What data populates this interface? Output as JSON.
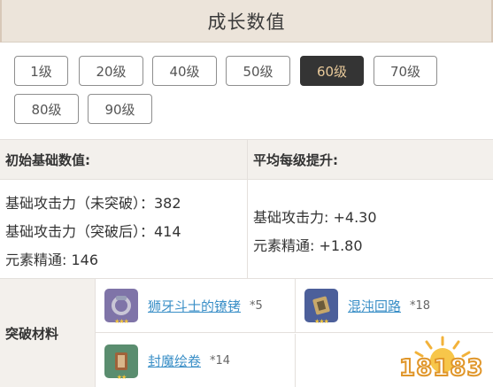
{
  "title": "成长数值",
  "levels": [
    {
      "label": "1级",
      "active": false
    },
    {
      "label": "20级",
      "active": false
    },
    {
      "label": "40级",
      "active": false
    },
    {
      "label": "50级",
      "active": false
    },
    {
      "label": "60级",
      "active": true
    },
    {
      "label": "70级",
      "active": false
    },
    {
      "label": "80级",
      "active": false
    },
    {
      "label": "90级",
      "active": false
    }
  ],
  "initial_stats": {
    "header": "初始基础数值:",
    "lines": [
      "基础攻击力（未突破）：382",
      "基础攻击力（突破后）：414",
      "元素精通: 146"
    ]
  },
  "growth_stats": {
    "header": "平均每级提升:",
    "lines": [
      "基础攻击力:  +4.30",
      "元素精通:  +1.80"
    ]
  },
  "materials": {
    "label": "突破材料",
    "items": [
      {
        "name": "狮牙斗士的镣铐",
        "count": "*5",
        "icon": "shackles-icon",
        "bg": "#7f74a8"
      },
      {
        "name": "混沌回路",
        "count": "*18",
        "icon": "circuit-icon",
        "bg": "#4c5f9a"
      },
      {
        "name": "封魔绘卷",
        "count": "*14",
        "icon": "scroll-icon",
        "bg": "#5a8d6f"
      }
    ]
  },
  "watermark": "18183",
  "colors": {
    "accent_active_bg": "#343434",
    "accent_active_text": "#e8c99a",
    "link": "#3a8fc7",
    "header_bg": "#ece4da"
  }
}
